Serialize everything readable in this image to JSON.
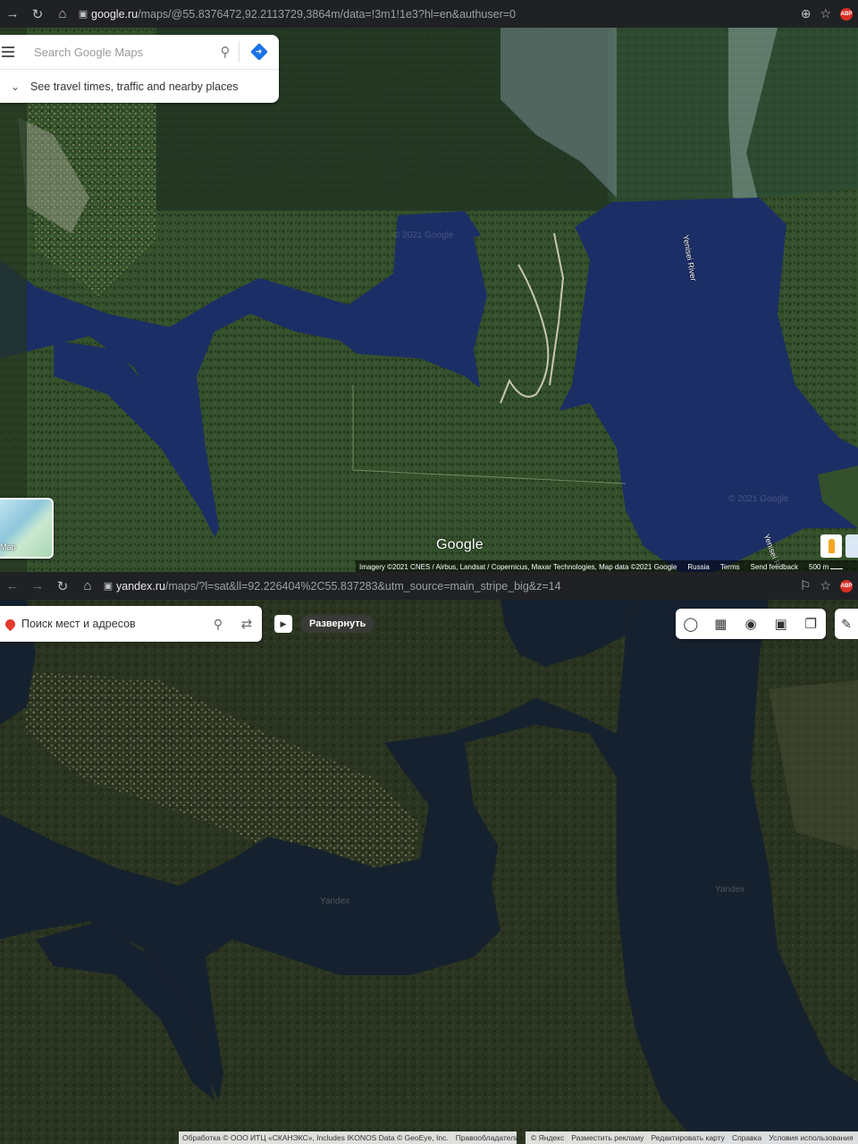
{
  "google": {
    "browser": {
      "url_host": "google.ru",
      "url_path": "/maps/@55.8376472,92.2113729,3864m/data=!3m1!1e3?hl=en&authuser=0"
    },
    "search": {
      "placeholder": "Search Google Maps",
      "travel_text": "See travel times, traffic and nearby places"
    },
    "layer_label": "Map",
    "logo": "Google",
    "river_label": "Yenisei River",
    "river_label_2": "Yenisei R",
    "watermark": "© 2021 Google",
    "footer": {
      "imagery": "Imagery ©2021 CNES / Airbus, Landsat / Copernicus, Maxar Technologies, Map data ©2021 Google",
      "country": "Russia",
      "terms": "Terms",
      "feedback": "Send feedback",
      "scale": "500 m"
    },
    "colors": {
      "water": "#1c2e66",
      "forest": "#2f4a2a",
      "panel": "#ffffff"
    }
  },
  "yandex": {
    "browser": {
      "url_host": "yandex.ru",
      "url_path": "/maps/?l=sat&ll=92.226404%2C55.837283&utm_source=main_stripe_big&z=14"
    },
    "search": {
      "placeholder": "Поиск мест и адресов"
    },
    "expand_label": "Развернуть",
    "watermark": "Yandex",
    "footer_left": "Обработка © ООО ИТЦ «СКАНЭКС», Includes IKONOS Data © GeoEye, Inc.",
    "footer_rights": "Правообладатели",
    "footer_links": [
      "© Яндекс",
      "Разместить рекламу",
      "Редактировать карту",
      "Справка",
      "Условия использования"
    ],
    "colors": {
      "water": "#16212f",
      "forest": "#2a3420",
      "accent": "#e63a2e"
    }
  },
  "icons": {
    "back": "←",
    "forward": "→",
    "reload": "↻",
    "home": "⌂",
    "lock": "🔒",
    "zoom": "⊕",
    "star": "☆",
    "search": "⚲",
    "chevron": "⌄",
    "play": "▶",
    "route": "⇄",
    "traffic": "◯",
    "layers": "❐",
    "panorama": "◉",
    "transit": "▣",
    "ruler": "✎"
  }
}
